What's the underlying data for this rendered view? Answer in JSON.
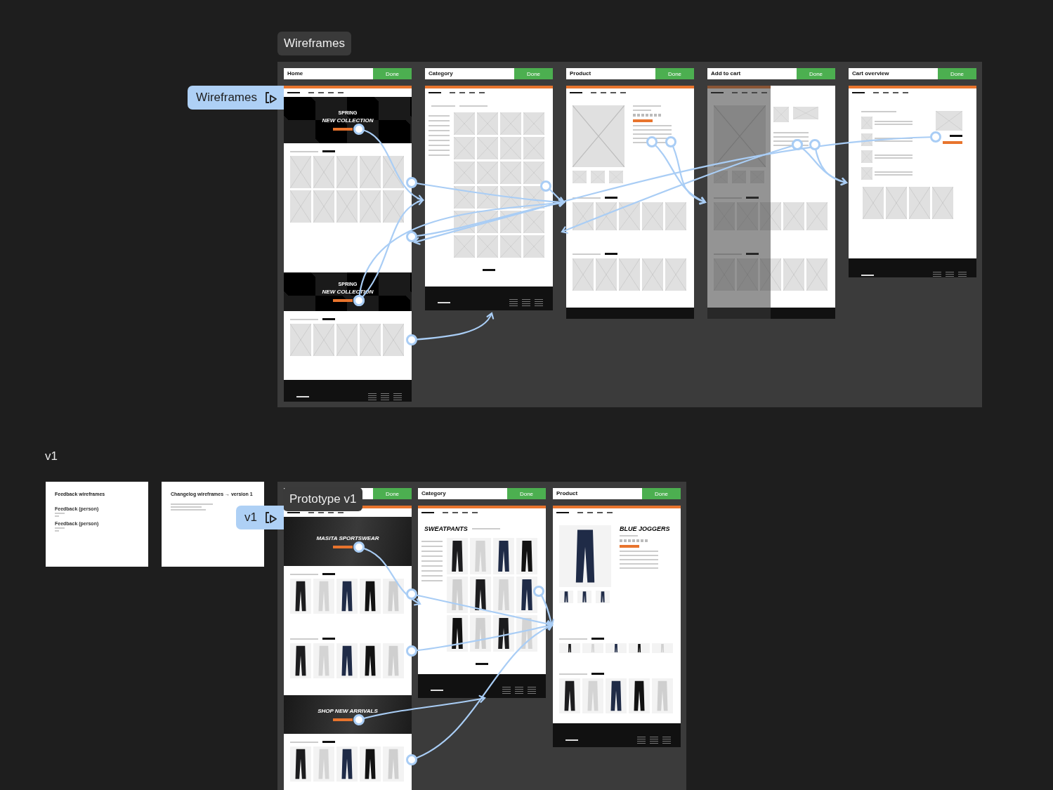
{
  "sections": [
    {
      "label": "Wireframes",
      "flow": "Wireframes",
      "kind": "wireframe",
      "frames": [
        {
          "kind": "home",
          "name": "Home",
          "button": "Done",
          "hero": [
            "SPRING",
            "NEW COLLECTION"
          ],
          "banner": [
            "SPRING",
            "NEW COLLECTION"
          ]
        },
        {
          "kind": "category",
          "name": "Category",
          "button": "Done"
        },
        {
          "kind": "product",
          "name": "Product",
          "button": "Done"
        },
        {
          "kind": "add_to_cart",
          "name": "Add to cart",
          "button": "Done"
        },
        {
          "kind": "cart",
          "name": "Cart overview",
          "button": "Done"
        }
      ]
    },
    {
      "label": "Prototype v1",
      "flow": "v1",
      "kind": "prototype",
      "frames": [
        {
          "kind": "home",
          "button": "Done",
          "hero": [
            "MASITA SPORTSWEAR"
          ],
          "banner": [
            "SHOP NEW ARRIVALS"
          ]
        },
        {
          "kind": "category",
          "name": "Category",
          "button": "Done",
          "title": "SWEATPANTS"
        },
        {
          "kind": "product",
          "name": "Product",
          "button": "Done",
          "title": "BLUE JOGGERS"
        }
      ]
    }
  ],
  "group_label": "v1",
  "notes": [
    {
      "title": "Feedback wireframes",
      "items": [
        "Feedback (person)",
        "Feedback (person)"
      ]
    },
    {
      "title": "Changelog wireframes → version 1"
    }
  ]
}
